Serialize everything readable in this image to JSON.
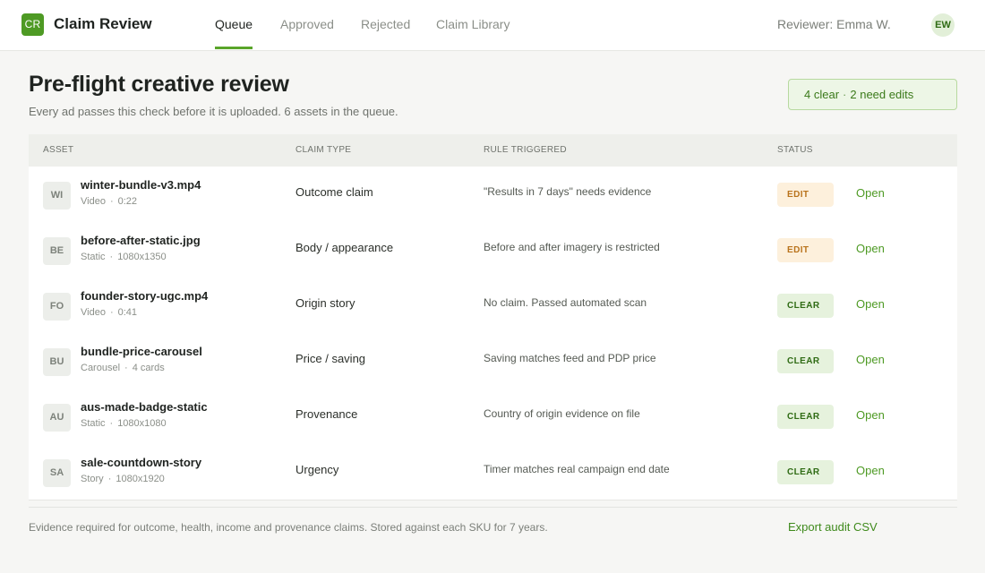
{
  "app": {
    "logo_text": "CR",
    "title": "Claim Review"
  },
  "nav": {
    "tabs": [
      {
        "label": "Queue",
        "active": true
      },
      {
        "label": "Approved",
        "active": false
      },
      {
        "label": "Rejected",
        "active": false
      },
      {
        "label": "Claim Library",
        "active": false
      }
    ]
  },
  "user": {
    "reviewer_label": "Reviewer: Emma W.",
    "initials": "EW"
  },
  "page": {
    "title": "Pre-flight creative review",
    "subtitle": "Every ad passes this check before it is uploaded. 6 assets in the queue."
  },
  "summary": {
    "clear_text": "4 clear",
    "separator": "·",
    "edits_text": "2 need edits"
  },
  "table": {
    "headers": {
      "asset": "ASSET",
      "claim_type": "CLAIM TYPE",
      "rule": "RULE TRIGGERED",
      "status": "STATUS"
    },
    "rows": [
      {
        "thumb": "WI",
        "name": "winter-bundle-v3.mp4",
        "format": "Video",
        "spec": "0:22",
        "claim_type": "Outcome claim",
        "rule": "\"Results in 7 days\" needs evidence",
        "status": "EDIT",
        "action": "Open"
      },
      {
        "thumb": "BE",
        "name": "before-after-static.jpg",
        "format": "Static",
        "spec": "1080x1350",
        "claim_type": "Body / appearance",
        "rule": "Before and after imagery is restricted",
        "status": "EDIT",
        "action": "Open"
      },
      {
        "thumb": "FO",
        "name": "founder-story-ugc.mp4",
        "format": "Video",
        "spec": "0:41",
        "claim_type": "Origin story",
        "rule": "No claim. Passed automated scan",
        "status": "CLEAR",
        "action": "Open"
      },
      {
        "thumb": "BU",
        "name": "bundle-price-carousel",
        "format": "Carousel",
        "spec": "4 cards",
        "claim_type": "Price / saving",
        "rule": "Saving matches feed and PDP price",
        "status": "CLEAR",
        "action": "Open"
      },
      {
        "thumb": "AU",
        "name": "aus-made-badge-static",
        "format": "Static",
        "spec": "1080x1080",
        "claim_type": "Provenance",
        "rule": "Country of origin evidence on file",
        "status": "CLEAR",
        "action": "Open"
      },
      {
        "thumb": "SA",
        "name": "sale-countdown-story",
        "format": "Story",
        "spec": "1080x1920",
        "claim_type": "Urgency",
        "rule": "Timer matches real campaign end date",
        "status": "CLEAR",
        "action": "Open"
      }
    ]
  },
  "footer": {
    "note": "Evidence required for outcome, health, income and provenance claims. Stored against each SKU for 7 years.",
    "export_label": "Export audit CSV"
  },
  "colors": {
    "accent": "#4e9a24",
    "edit_bg": "#fdf0dc",
    "edit_text": "#b9731c",
    "clear_bg": "#e6f2dd",
    "clear_text": "#2f6b14"
  }
}
